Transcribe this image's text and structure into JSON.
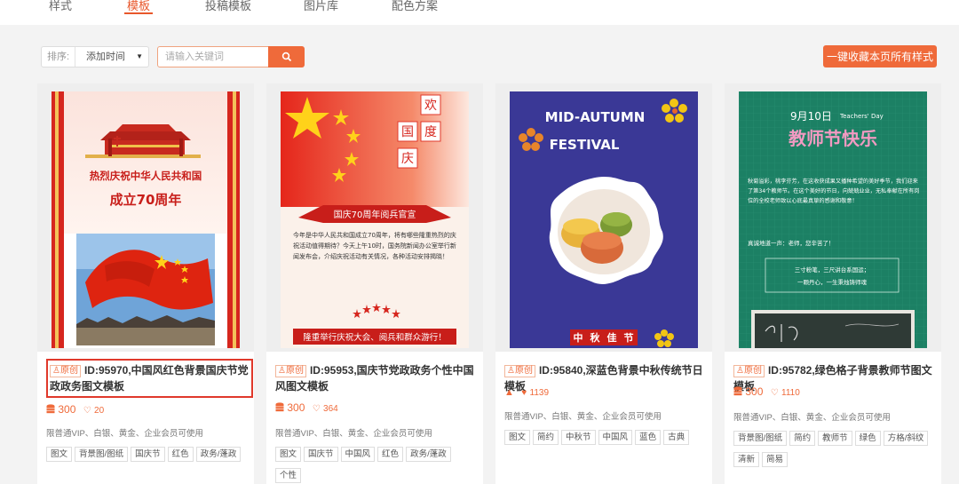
{
  "nav": {
    "tabs": [
      "样式",
      "模板",
      "投稿模板",
      "图片库",
      "配色方案"
    ],
    "active_index": 1
  },
  "toolbar": {
    "sort_label": "排序:",
    "sort_value": "添加时间",
    "search_placeholder": "请输入关键词",
    "collect_label": "一键收藏本页所有样式"
  },
  "colors": {
    "accent": "#ef6a3a",
    "highlight": "#e0392b"
  },
  "cards": [
    {
      "badge": "原创",
      "title": "ID:95970,中国风红色背景国庆节党政政务图文模板",
      "price": "300",
      "likes": "20",
      "permission": "限普通VIP、白银、黄金、企业会员可使用",
      "tags": [
        "图文",
        "背景图/图纸",
        "国庆节",
        "红色",
        "政务/蓬政"
      ],
      "poster": {
        "line1": "热烈庆祝中华人民共和国",
        "line2": "成立70周年"
      }
    },
    {
      "badge": "原创",
      "title": "ID:95953,国庆节党政政务个性中国风图文模板",
      "price": "300",
      "likes": "364",
      "permission": "限普通VIP、白银、黄金、企业会员可使用",
      "tags": [
        "图文",
        "国庆节",
        "中国风",
        "红色",
        "政务/蓬政",
        "个性"
      ],
      "poster": {
        "chars": [
          "欢",
          "度",
          "国",
          "庆"
        ],
        "banner": "国庆70周年阅兵官宣",
        "body": "今年是中华人民共和国成立70周年，将有哪些隆重热烈的庆祝活动值得期待？今天上午10时，国务院新闻办公室举行新闻发布会，介绍庆祝活动有关情况，各种活动安排揭晓！",
        "footer": "隆重举行庆祝大会、阅兵和群众游行！"
      }
    },
    {
      "badge": "原创",
      "title": "ID:95840,深蓝色背景中秋传统节日模板",
      "price": "",
      "likes": "1139",
      "permission": "限普通VIP、白银、黄金、企业会员可使用",
      "tags": [
        "图文",
        "简约",
        "中秋节",
        "中国风",
        "蓝色",
        "古典"
      ],
      "poster": {
        "line1": "MID-AUTUMN",
        "line2": "FESTIVAL",
        "chars": [
          "中",
          "秋",
          "佳",
          "节"
        ]
      }
    },
    {
      "badge": "原创",
      "title": "ID:95782,绿色格子背景教师节图文模板",
      "price": "300",
      "likes": "1110",
      "permission": "限普通VIP、白银、黄金、企业会员可使用",
      "tags": [
        "背景图/图纸",
        "简约",
        "教师节",
        "绿色",
        "方格/斜纹",
        "清新",
        "简易"
      ],
      "poster": {
        "date": "9月10日",
        "en": "Teachers' Day",
        "title": "教师节快乐",
        "body": "秋菊溢彩，桃李芬芳，在这收获成果又播种希望的美好季节，我们迎来了第34个教师节。在这个美好的节日，向兢兢业业，无私奉献在所有岗位的全校老师致以心底最真挚的感谢和敬意！",
        "greet": "真诚地道一声：老师，您辛苦了！",
        "verse1": "三寸粉笔，三尺讲台系国运；",
        "verse2": "一颗丹心，一生秉烛铸师魂"
      }
    }
  ]
}
